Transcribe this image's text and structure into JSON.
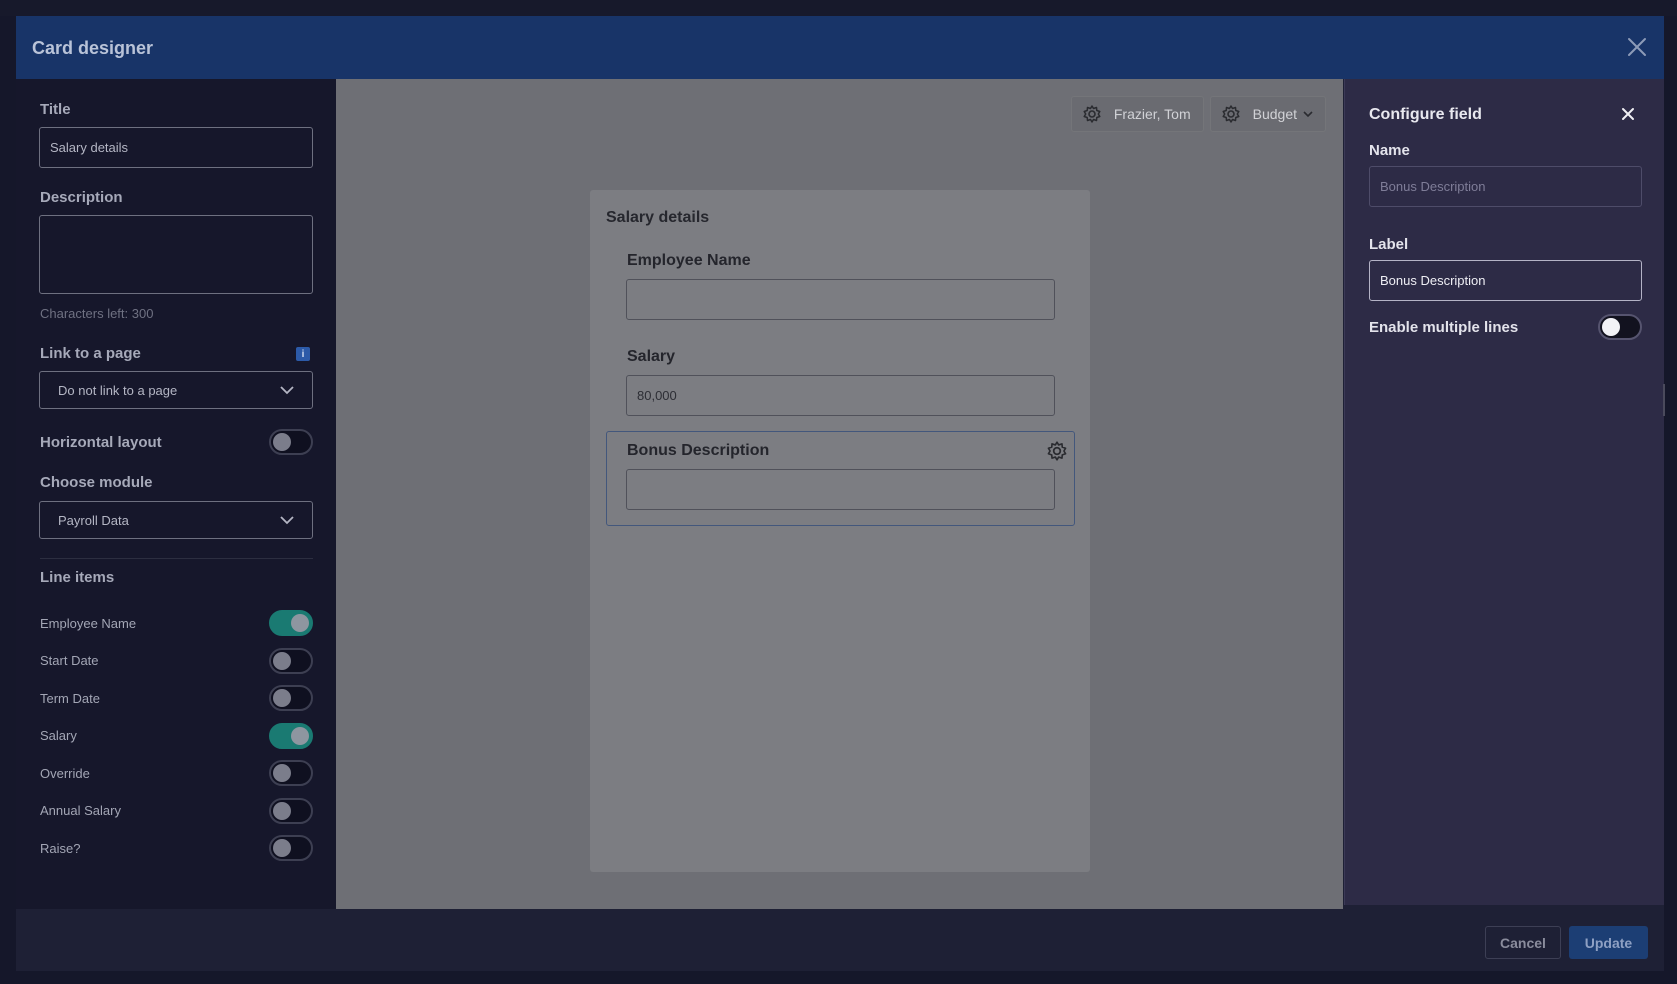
{
  "window": {
    "title": "Card designer"
  },
  "left_panel": {
    "title_label": "Title",
    "title_value": "Salary details",
    "description_label": "Description",
    "description_value": "",
    "chars_left": "Characters left: 300",
    "link_label": "Link to a page",
    "link_info_icon": "i",
    "link_value": "Do not link to a page",
    "horizontal_layout_label": "Horizontal layout",
    "horizontal_layout_on": false,
    "module_label": "Choose module",
    "module_value": "Payroll Data",
    "line_items_label": "Line items",
    "line_items": [
      {
        "label": "Employee Name",
        "on": true
      },
      {
        "label": "Start Date",
        "on": false
      },
      {
        "label": "Term Date",
        "on": false
      },
      {
        "label": "Salary",
        "on": true
      },
      {
        "label": "Override",
        "on": false
      },
      {
        "label": "Annual Salary",
        "on": false
      },
      {
        "label": "Raise?",
        "on": false
      }
    ]
  },
  "canvas": {
    "toolbar": {
      "user_label": "Frazier, Tom",
      "version_label": "Budget"
    },
    "card": {
      "title": "Salary details",
      "fields": [
        {
          "label": "Employee Name",
          "value": ""
        },
        {
          "label": "Salary",
          "value": "80,000"
        },
        {
          "label": "Bonus Description",
          "value": ""
        }
      ]
    }
  },
  "right_panel": {
    "title": "Configure field",
    "name_label": "Name",
    "name_value": "Bonus Description",
    "label_label": "Label",
    "label_value": "Bonus Description",
    "multiline_label": "Enable multiple lines",
    "multiline_on": false
  },
  "footer": {
    "cancel_label": "Cancel",
    "update_label": "Update"
  },
  "colors": {
    "header_bg": "#183468",
    "toggle_on": "#1a7a72",
    "primary_button": "#1c3e74",
    "right_panel_bg": "#2d2b46"
  },
  "icons": {
    "modal_close": "close-icon",
    "panel_close": "close-icon",
    "gear": "gear-icon",
    "chevron": "chevron-down-icon",
    "info": "info-icon"
  }
}
